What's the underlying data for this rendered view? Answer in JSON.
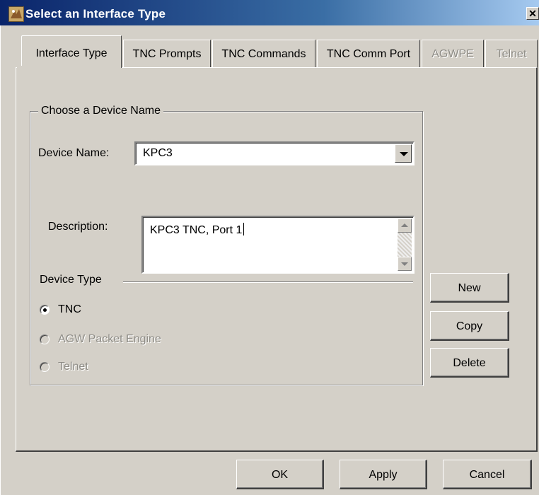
{
  "window": {
    "title": "Select an Interface Type",
    "close_symbol": "✕"
  },
  "tabs": [
    {
      "label": "Interface Type",
      "active": true,
      "enabled": true
    },
    {
      "label": "TNC Prompts",
      "active": false,
      "enabled": true
    },
    {
      "label": "TNC Commands",
      "active": false,
      "enabled": true
    },
    {
      "label": "TNC Comm Port",
      "active": false,
      "enabled": true
    },
    {
      "label": "AGWPE",
      "active": false,
      "enabled": false
    },
    {
      "label": "Telnet",
      "active": false,
      "enabled": false
    }
  ],
  "device_group": {
    "legend": "Choose a Device Name",
    "device_name_label": "Device Name:",
    "device_name_value": "KPC3",
    "description_label": "Description:",
    "description_value": "KPC3 TNC, Port 1",
    "device_type_label": "Device Type",
    "device_types": [
      {
        "label": "TNC",
        "checked": true,
        "enabled": true
      },
      {
        "label": "AGW Packet Engine",
        "checked": false,
        "enabled": false
      },
      {
        "label": "Telnet",
        "checked": false,
        "enabled": false
      }
    ]
  },
  "side_buttons": {
    "new": "New",
    "copy": "Copy",
    "delete": "Delete"
  },
  "footer_buttons": {
    "ok": "OK",
    "apply": "Apply",
    "cancel": "Cancel"
  },
  "colors": {
    "dialog_face": "#d4d0c8",
    "title_bar": "#0a246a",
    "disabled_text": "#8e8c86"
  }
}
